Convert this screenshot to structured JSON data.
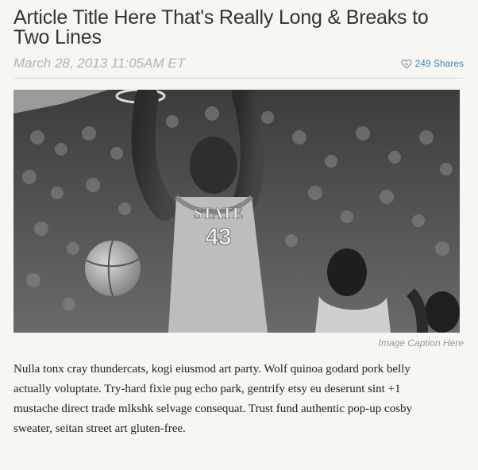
{
  "article": {
    "title": "Article Title Here That's Really Long & Breaks to Two Lines",
    "date": "March 28, 2013 11:05AM ET",
    "shares": "249 Shares",
    "caption": "Image Caption Here",
    "body": "Nulla tonx cray thundercats, kogi eiusmod art party. Wolf quinoa godard pork belly actually voluptate. Try-hard fixie pug echo park, gentrify etsy eu deserunt sint +1 mustache direct trade mlkshk selvage consequat. Trust fund authentic pop-up cosby sweater, seitan street art gluten-free.",
    "photo": {
      "jersey_text": "STATE",
      "jersey_number": "43"
    }
  },
  "icons": {
    "share_icon": "heart-share-icon"
  },
  "colors": {
    "link": "#3a86b5",
    "title": "#333333",
    "date": "#b3b3b3",
    "caption": "#9a9a9a",
    "background": "#f7f6f3"
  }
}
